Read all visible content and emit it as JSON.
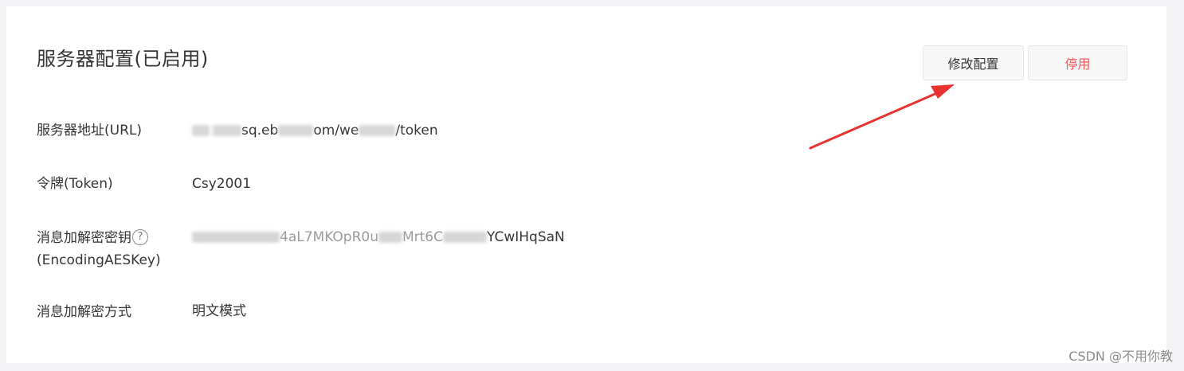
{
  "panel": {
    "title": "服务器配置(已启用)",
    "edit_label": "修改配置",
    "stop_label": "停用"
  },
  "rows": [
    {
      "label": "服务器地址(URL)",
      "value_prefix": "ht",
      "value_mid": "sq.eb",
      "value_mid2": "om/we",
      "value_suffix": "/token"
    },
    {
      "label": "令牌(Token)",
      "value": "Csy2001"
    },
    {
      "label_line1": "消息加解密密钥",
      "label_line2": "(EncodingAESKey)",
      "help": "?",
      "value_mid": "4aL7MKOpR0u",
      "value_mid2": "Mrt6C",
      "value_suffix": "YCwIHqSaN"
    },
    {
      "label": "消息加解密方式",
      "value": "明文模式"
    }
  ],
  "watermark": "CSDN @不用你教",
  "colors": {
    "danger": "#fa5151",
    "annotation_arrow": "#e8322f"
  }
}
